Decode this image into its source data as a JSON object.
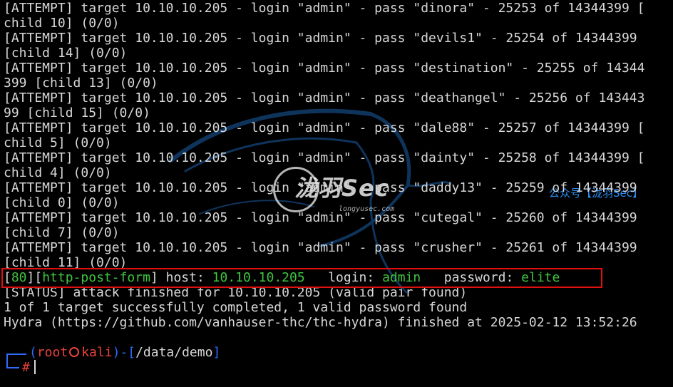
{
  "colors": {
    "background": "#000000",
    "text": "#d7d7d7",
    "success_green": "#3ec53e",
    "prompt_blue": "#2f6bff",
    "prompt_red": "#e8423a",
    "highlight_box": "#e01010",
    "watermark_blue": "#2a8cf0"
  },
  "attempt_lines": [
    {
      "line1": "[ATTEMPT] target 10.10.10.205 - login \"admin\" - pass \"dinora\" - 25253 of 14344399 [",
      "line2": "child 10] (0/0)"
    },
    {
      "line1": "[ATTEMPT] target 10.10.10.205 - login \"admin\" - pass \"devils1\" - 25254 of 14344399",
      "line2": "[child 14] (0/0)"
    },
    {
      "line1": "[ATTEMPT] target 10.10.10.205 - login \"admin\" - pass \"destination\" - 25255 of 14344",
      "line2": "399 [child 13] (0/0)"
    },
    {
      "line1": "[ATTEMPT] target 10.10.10.205 - login \"admin\" - pass \"deathangel\" - 25256 of 143443",
      "line2": "99 [child 15] (0/0)"
    },
    {
      "line1": "[ATTEMPT] target 10.10.10.205 - login \"admin\" - pass \"dale88\" - 25257 of 14344399 [",
      "line2": "child 5] (0/0)"
    },
    {
      "line1": "[ATTEMPT] target 10.10.10.205 - login \"admin\" - pass \"dainty\" - 25258 of 14344399 [",
      "line2": "child 4] (0/0)"
    },
    {
      "line1": "[ATTEMPT] target 10.10.10.205 - login \"admin\" - pass \"daddy13\" - 25259 of 14344399",
      "line2": "[child 0] (0/0)"
    },
    {
      "line1": "[ATTEMPT] target 10.10.10.205 - login \"admin\" - pass \"cutegal\" - 25260 of 14344399",
      "line2": "[child 7] (0/0)"
    },
    {
      "line1": "[ATTEMPT] target 10.10.10.205 - login \"admin\" - pass \"crusher\" - 25261 of 14344399",
      "line2": "[child 11] (0/0)"
    }
  ],
  "result": {
    "bracket_open_1": "[",
    "port": "80",
    "bracket_mid": "][",
    "service": "http-post-form",
    "bracket_close": "]",
    "host_label": " host: ",
    "host": "10.10.10.205",
    "login_label": "   login: ",
    "login": "admin",
    "password_label": "   password: ",
    "password": "elite"
  },
  "status_lines": [
    "[STATUS] attack finished for 10.10.10.205 (valid pair found)",
    "1 of 1 target successfully completed, 1 valid password found",
    "Hydra (https://github.com/vanhauser-thc/thc-hydra) finished at 2025-02-12 13:52:26"
  ],
  "prompt": {
    "open": "(",
    "user": "root",
    "host": "kali",
    "close": ")-[",
    "path": "/data/demo",
    "path_close": "]",
    "symbol": "#"
  },
  "watermark": {
    "title": "泷羽Sec",
    "subtitle": "longyusec.com",
    "tag": "公众号【泷羽Sec】"
  }
}
